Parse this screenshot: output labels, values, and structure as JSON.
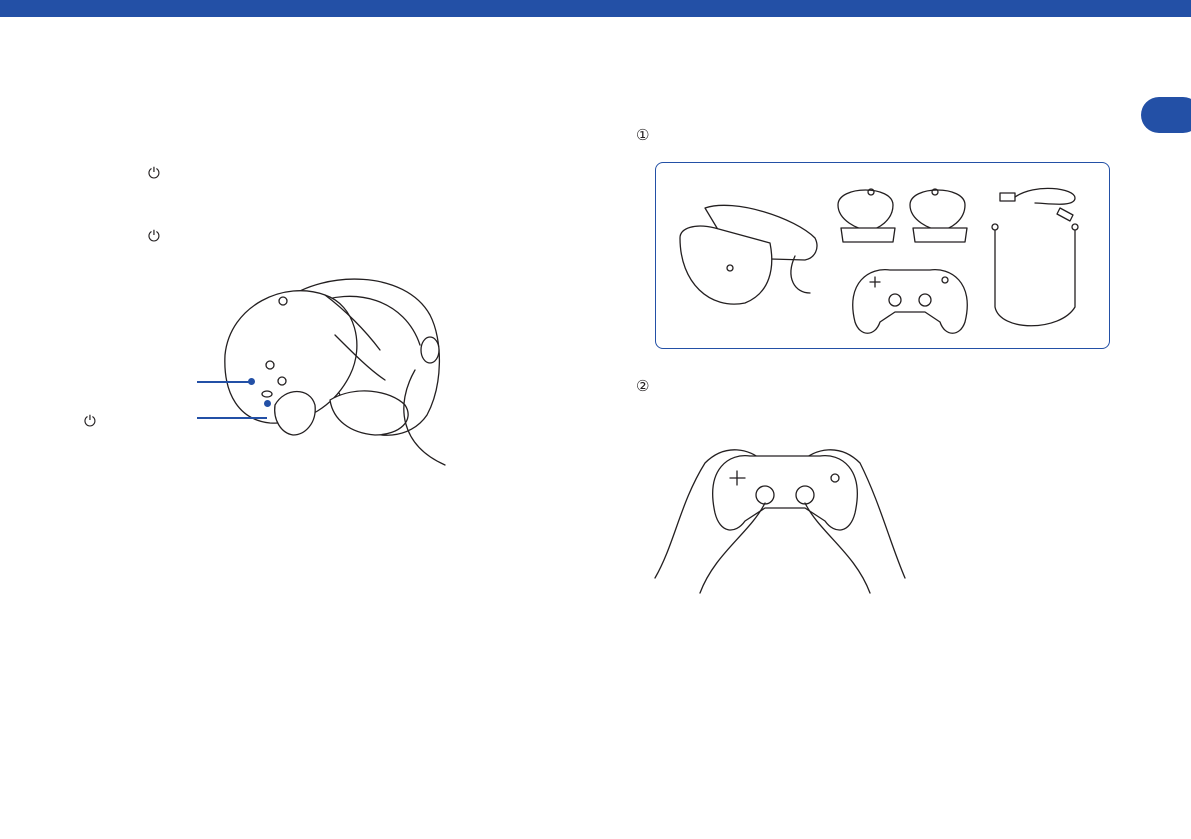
{
  "page": {
    "header_color": "#2350a6",
    "accent_color": "#2350a6"
  },
  "left_column": {
    "steps": [
      {
        "power_icon": "power-icon"
      },
      {
        "power_icon": "power-icon"
      }
    ],
    "headset_figure": {
      "callouts": [
        {
          "label_icon": ""
        },
        {
          "label_icon": "power-icon"
        }
      ]
    }
  },
  "right_column": {
    "step_1_marker": "①",
    "step_2_marker": "②",
    "box_contents": [
      "headset",
      "sense-controllers",
      "usb-cable",
      "stereo-headphones",
      "wireless-controller"
    ]
  },
  "glyphs": {
    "power": "⏻"
  }
}
